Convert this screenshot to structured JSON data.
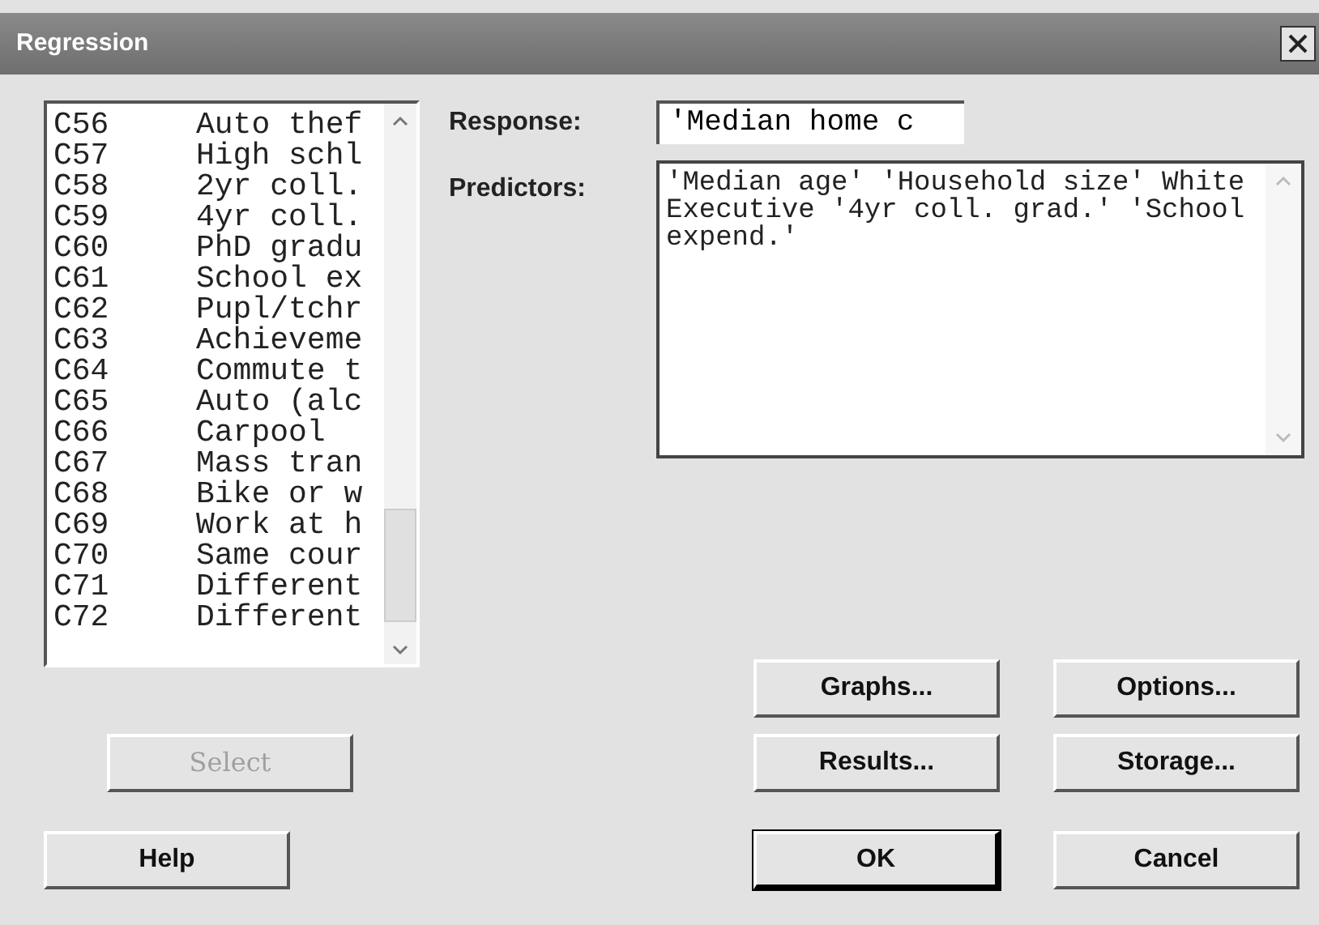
{
  "window": {
    "title": "Regression"
  },
  "variables": [
    {
      "column": "C56",
      "name": "Auto thef"
    },
    {
      "column": "C57",
      "name": "High schl"
    },
    {
      "column": "C58",
      "name": "2yr coll."
    },
    {
      "column": "C59",
      "name": "4yr coll."
    },
    {
      "column": "C60",
      "name": "PhD gradu"
    },
    {
      "column": "C61",
      "name": "School ex"
    },
    {
      "column": "C62",
      "name": "Pupl/tchr"
    },
    {
      "column": "C63",
      "name": "Achieveme"
    },
    {
      "column": "C64",
      "name": "Commute t"
    },
    {
      "column": "C65",
      "name": "Auto (alc"
    },
    {
      "column": "C66",
      "name": "Carpool"
    },
    {
      "column": "C67",
      "name": "Mass tran"
    },
    {
      "column": "C68",
      "name": "Bike or w"
    },
    {
      "column": "C69",
      "name": "Work at h"
    },
    {
      "column": "C70",
      "name": "Same cour"
    },
    {
      "column": "C71",
      "name": "Different"
    },
    {
      "column": "C72",
      "name": "Different"
    }
  ],
  "response": {
    "label": "Response:",
    "value": "'Median home c"
  },
  "predictors": {
    "label": "Predictors:",
    "value": "'Median age' 'Household size' White Executive '4yr coll. grad.' 'School expend.'"
  },
  "buttons": [
    {
      "label": "Graphs...",
      "disabled": false,
      "default": false
    },
    {
      "label": "Options...",
      "disabled": false,
      "default": false
    },
    {
      "label": "Select",
      "disabled": true,
      "default": false
    },
    {
      "label": "Results...",
      "disabled": false,
      "default": false
    },
    {
      "label": "Storage...",
      "disabled": false,
      "default": false
    },
    {
      "label": "Help",
      "disabled": false,
      "default": false
    },
    {
      "label": "OK",
      "disabled": false,
      "default": true
    },
    {
      "label": "Cancel",
      "disabled": false,
      "default": false
    }
  ]
}
